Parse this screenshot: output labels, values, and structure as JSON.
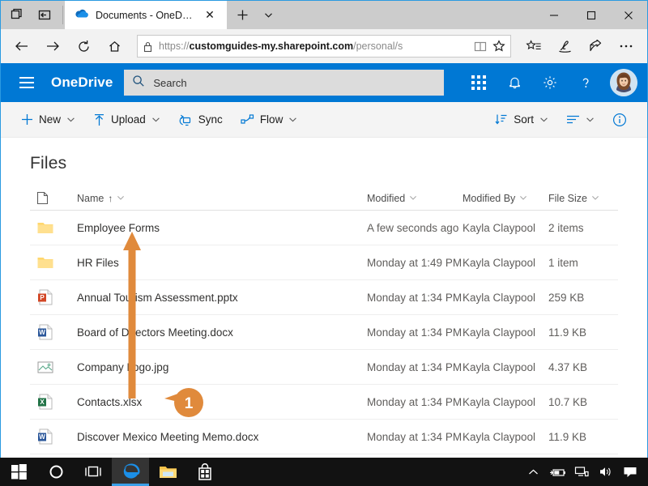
{
  "browser": {
    "tab": {
      "title": "Documents - OneDrive",
      "icon": "onedrive-cloud-icon",
      "close_label": "✕"
    },
    "new_tab_label": "+",
    "tab_dropdown_label": "⌄",
    "window_controls": {
      "minimize": "—",
      "maximize": "□",
      "close": "✕"
    },
    "nav": {
      "back": "←",
      "forward": "→",
      "refresh": "↻",
      "home": "⌂"
    },
    "address": {
      "lock_icon": "padlock-icon",
      "prefix": "https://",
      "domain": "customguides-my.sharepoint.com",
      "path": "/personal/s",
      "reading_view_icon": "reading-view-icon",
      "favorite_icon": "star-icon"
    },
    "toolbar_right": [
      "hub-favorites-icon",
      "web-notes-icon",
      "share-icon",
      "more-icon"
    ]
  },
  "suitebar": {
    "menu_icon": "hamburger-icon",
    "brand": "OneDrive",
    "search": {
      "placeholder": "Search",
      "icon": "search-icon"
    },
    "icons": [
      "app-launcher-icon",
      "notifications-bell-icon",
      "settings-gear-icon",
      "help-question-icon"
    ],
    "avatar": "user-avatar",
    "accent_color": "#0078d4"
  },
  "commandbar": {
    "items": [
      {
        "label": "New",
        "icon": "plus-icon",
        "has_chevron": true
      },
      {
        "label": "Upload",
        "icon": "upload-arrow-icon",
        "has_chevron": true
      },
      {
        "label": "Sync",
        "icon": "sync-icon",
        "has_chevron": false
      },
      {
        "label": "Flow",
        "icon": "flow-icon",
        "has_chevron": true
      }
    ],
    "right": [
      {
        "label": "Sort",
        "icon": "sort-icon",
        "has_chevron": true
      },
      {
        "label": "",
        "icon": "view-list-icon",
        "has_chevron": true
      },
      {
        "label": "",
        "icon": "info-circle-icon",
        "has_chevron": false
      }
    ]
  },
  "page": {
    "title": "Files"
  },
  "table": {
    "columns": {
      "icon": "file-type-column-icon",
      "name": "Name",
      "name_sort": "↑",
      "modified": "Modified",
      "modified_by": "Modified By",
      "file_size": "File Size"
    },
    "rows": [
      {
        "icon": "folder-icon",
        "name": "Employee Forms",
        "modified": "A few seconds ago",
        "modified_by": "Kayla Claypool",
        "size": "2 items"
      },
      {
        "icon": "folder-icon",
        "name": "HR Files",
        "modified": "Monday at 1:49 PM",
        "modified_by": "Kayla Claypool",
        "size": "1 item"
      },
      {
        "icon": "powerpoint-icon",
        "name": "Annual Tourism Assessment.pptx",
        "modified": "Monday at 1:34 PM",
        "modified_by": "Kayla Claypool",
        "size": "259 KB"
      },
      {
        "icon": "word-icon",
        "name": "Board of Directors Meeting.docx",
        "modified": "Monday at 1:34 PM",
        "modified_by": "Kayla Claypool",
        "size": "11.9 KB"
      },
      {
        "icon": "image-icon",
        "name": "Company Logo.jpg",
        "modified": "Monday at 1:34 PM",
        "modified_by": "Kayla Claypool",
        "size": "4.37 KB"
      },
      {
        "icon": "excel-icon",
        "name": "Contacts.xlsx",
        "modified": "Monday at 1:34 PM",
        "modified_by": "Kayla Claypool",
        "size": "10.7 KB"
      },
      {
        "icon": "word-icon",
        "name": "Discover Mexico Meeting Memo.docx",
        "modified": "Monday at 1:34 PM",
        "modified_by": "Kayla Claypool",
        "size": "11.9 KB"
      }
    ]
  },
  "annotation": {
    "callout_number": "1",
    "color": "#e08a3c",
    "arrow_from_row": "Contacts.xlsx",
    "arrow_to_row": "Employee Forms"
  },
  "taskbar": {
    "items": [
      "start-windows-icon",
      "cortana-circle-icon",
      "task-view-icon",
      "edge-browser-icon",
      "file-explorer-icon",
      "microsoft-store-icon"
    ],
    "tray": [
      "show-hidden-icons-chevron",
      "battery-icon",
      "network-icon",
      "volume-icon",
      "action-center-icon"
    ],
    "active": "edge-browser-icon"
  }
}
